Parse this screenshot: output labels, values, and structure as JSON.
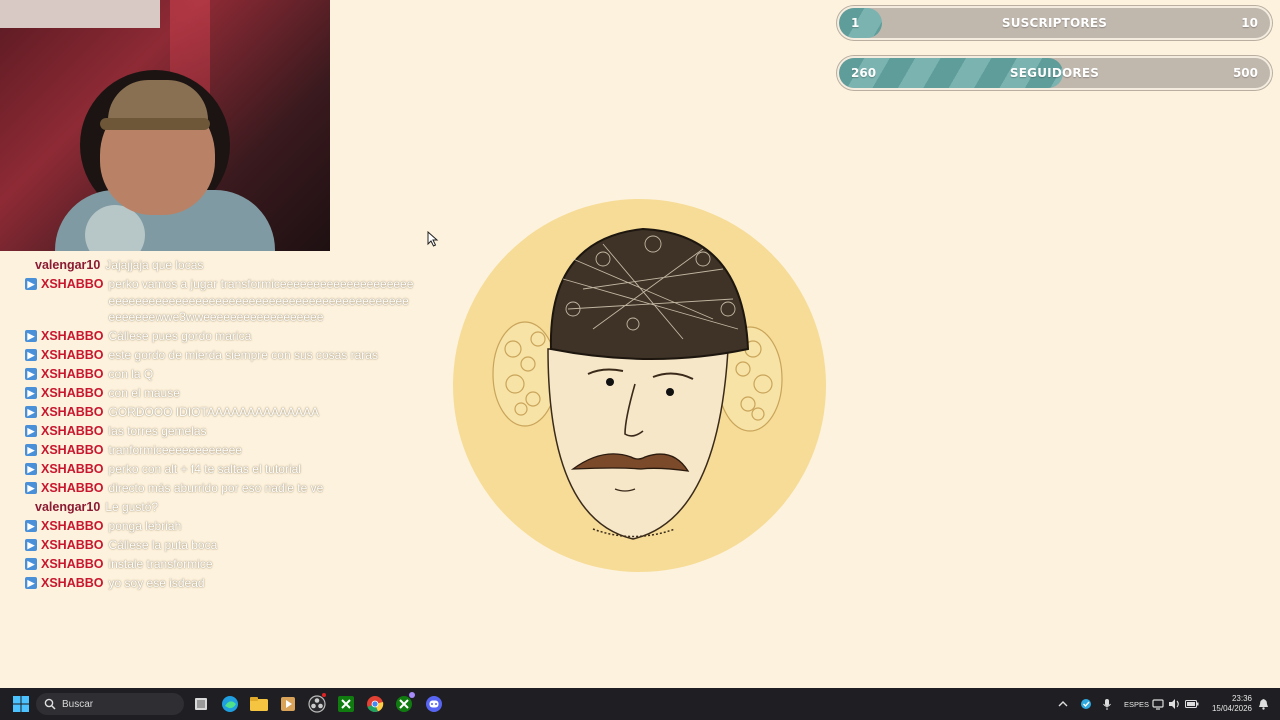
{
  "goals": [
    {
      "current": "1",
      "label": "SUSCRIPTORES",
      "max": "10",
      "progress": 0.1
    },
    {
      "current": "260",
      "label": "SEGUIDORES",
      "max": "500",
      "progress": 0.52
    }
  ],
  "chat": [
    {
      "user": "valengar10",
      "text": "Jajajjaja que locas",
      "badge": false,
      "color": "dark"
    },
    {
      "user": "XSHABBO",
      "text": "perko vamos a jugar transformiceeeeeeeeeeeeeeeeeeeeeeeeeeeeeeeeeeeeeeeeeeeeeeeeeeeeeeeeeeeeeeeeeeeeeeeewwe3wweeeeeeeeeeeeeeeeee",
      "badge": true,
      "color": "red"
    },
    {
      "user": "XSHABBO",
      "text": "Cállese pues gordo marica",
      "badge": true,
      "color": "red"
    },
    {
      "user": "XSHABBO",
      "text": "este gordo de mierda siempre con sus cosas raras",
      "badge": true,
      "color": "red"
    },
    {
      "user": "XSHABBO",
      "text": "con la Q",
      "badge": true,
      "color": "red"
    },
    {
      "user": "XSHABBO",
      "text": "con el mause",
      "badge": true,
      "color": "red"
    },
    {
      "user": "XSHABBO",
      "text": "GORDOOO IDIOTAAAAAAAAAAAAAA",
      "badge": true,
      "color": "red"
    },
    {
      "user": "XSHABBO",
      "text": "las torres gemelas",
      "badge": true,
      "color": "red"
    },
    {
      "user": "XSHABBO",
      "text": "tranformiceeeeeeeeeeee",
      "badge": true,
      "color": "red"
    },
    {
      "user": "XSHABBO",
      "text": "perko con alt + f4 te saltas el tutorial",
      "badge": true,
      "color": "red"
    },
    {
      "user": "XSHABBO",
      "text": "directo más aburrido por eso nadie te ve",
      "badge": true,
      "color": "red"
    },
    {
      "user": "valengar10",
      "text": "Le gustó?",
      "badge": false,
      "color": "dark"
    },
    {
      "user": "XSHABBO",
      "text": "ponga lebriah",
      "badge": true,
      "color": "red"
    },
    {
      "user": "XSHABBO",
      "text": "Cállese la puta boca",
      "badge": true,
      "color": "red"
    },
    {
      "user": "XSHABBO",
      "text": "instale transformice",
      "badge": true,
      "color": "red"
    },
    {
      "user": "XSHABBO",
      "text": "yo soy ese isdead",
      "badge": true,
      "color": "red"
    }
  ],
  "taskbar": {
    "search_placeholder": "Buscar",
    "lang_top": "ESP",
    "lang_bottom": "ES",
    "time": "23:36",
    "date": "15/04/2026"
  },
  "colors": {
    "background": "#fdf2dd",
    "goal_fill": "#6aa6a3",
    "goal_track": "#c0b7ad",
    "avatar_circle": "#f6dc97",
    "chat_user_red": "#c8162e",
    "badge_blue": "#4a90d9"
  }
}
